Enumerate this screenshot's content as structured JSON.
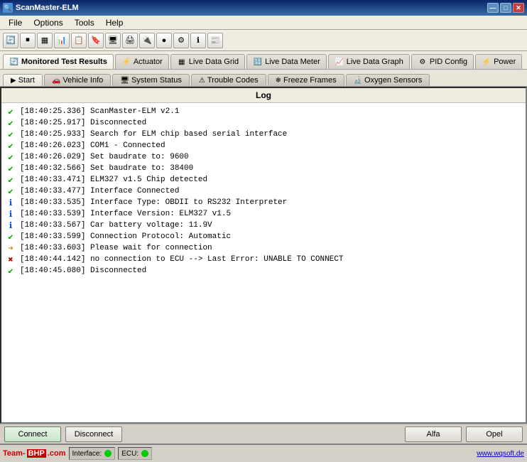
{
  "titleBar": {
    "title": "ScanMaster-ELM",
    "minBtn": "—",
    "maxBtn": "□",
    "closeBtn": "✕"
  },
  "menuBar": {
    "items": [
      "File",
      "Options",
      "Tools",
      "Help"
    ]
  },
  "tabsTop": [
    {
      "id": "monitored",
      "label": "Monitored Test Results",
      "active": true
    },
    {
      "id": "actuator",
      "label": "Actuator"
    },
    {
      "id": "livedatagrid",
      "label": "Live Data Grid"
    },
    {
      "id": "livedatameter",
      "label": "Live Data Meter"
    },
    {
      "id": "livedatagraph",
      "label": "Live Data Graph"
    },
    {
      "id": "pidconfig",
      "label": "PID Config"
    },
    {
      "id": "power",
      "label": "Power"
    }
  ],
  "tabsSecond": [
    {
      "id": "start",
      "label": "Start",
      "active": true
    },
    {
      "id": "vehicleinfo",
      "label": "Vehicle Info"
    },
    {
      "id": "systemstatus",
      "label": "System Status"
    },
    {
      "id": "troublecodes",
      "label": "Trouble Codes"
    },
    {
      "id": "freezeframes",
      "label": "Freeze Frames"
    },
    {
      "id": "oxygensensors",
      "label": "Oxygen Sensors"
    }
  ],
  "logHeader": "Log",
  "logEntries": [
    {
      "id": 1,
      "type": "check",
      "text": "[18:40:25.336] ScanMaster-ELM v2.1"
    },
    {
      "id": 2,
      "type": "check",
      "text": "[18:40:25.917] Disconnected"
    },
    {
      "id": 3,
      "type": "check",
      "text": "[18:40:25.933] Search for ELM chip based serial interface"
    },
    {
      "id": 4,
      "type": "check",
      "text": "[18:40:26.023] COM1 - Connected"
    },
    {
      "id": 5,
      "type": "check",
      "text": "[18:40:26.029] Set baudrate to: 9600"
    },
    {
      "id": 6,
      "type": "check",
      "text": "[18:40:32.566] Set baudrate to: 38400"
    },
    {
      "id": 7,
      "type": "check",
      "text": "[18:40:33.471] ELM327 v1.5 Chip detected"
    },
    {
      "id": 8,
      "type": "check",
      "text": "[18:40:33.477] Interface Connected"
    },
    {
      "id": 9,
      "type": "info",
      "text": "[18:40:33.535] Interface Type: OBDII to RS232 Interpreter"
    },
    {
      "id": 10,
      "type": "info",
      "text": "[18:40:33.539] Interface Version: ELM327 v1.5"
    },
    {
      "id": 11,
      "type": "info",
      "text": "[18:40:33.567] Car battery voltage: 11.9V"
    },
    {
      "id": 12,
      "type": "check",
      "text": "[18:40:33.599] Connection Protocol: Automatic"
    },
    {
      "id": 13,
      "type": "warn",
      "text": "[18:40:33.603] Please wait for connection"
    },
    {
      "id": 14,
      "type": "error",
      "text": "[18:40:44.142] no connection to ECU --> Last Error: UNABLE TO CONNECT"
    },
    {
      "id": 15,
      "type": "check",
      "text": "[18:40:45.080] Disconnected"
    }
  ],
  "bottomButtons": {
    "connect": "Connect",
    "disconnect": "Disconnect",
    "alfa": "Alfa",
    "opel": "Opel"
  },
  "statusBar": {
    "interfaceLabel": "Interface:",
    "ecuLabel": "ECU:",
    "website": "www.wqsoft.de",
    "logoText1": "Team-",
    "logoText2": "BHP",
    "logoText3": ".com"
  }
}
